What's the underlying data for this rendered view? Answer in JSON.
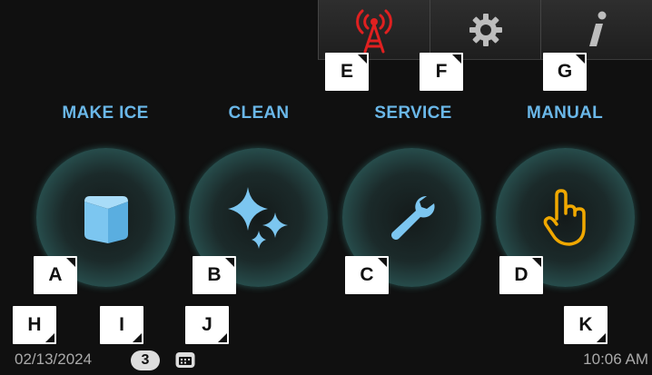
{
  "header": {
    "tabs": [
      {
        "icon": "antenna-icon",
        "marker": "E"
      },
      {
        "icon": "gear-icon",
        "marker": "F"
      },
      {
        "icon": "info-icon",
        "marker": "G"
      }
    ]
  },
  "modes": [
    {
      "label": "MAKE ICE",
      "icon": "ice-cube-icon",
      "marker": "A"
    },
    {
      "label": "CLEAN",
      "icon": "sparkle-icon",
      "marker": "B"
    },
    {
      "label": "SERVICE",
      "icon": "wrench-icon",
      "marker": "C"
    },
    {
      "label": "MANUAL",
      "icon": "hand-pointer-icon",
      "marker": "D"
    }
  ],
  "status": {
    "date": "02/13/2024",
    "count": "3",
    "time": "10:06 AM",
    "markers": {
      "date": "H",
      "count": "I",
      "calendar": "J",
      "time": "K"
    }
  },
  "colors": {
    "label": "#6ab7e8",
    "antenna": "#e02020",
    "icon_blue": "#7cc6f0",
    "hand": "#f0a800",
    "ring": "#4aa8a4"
  }
}
